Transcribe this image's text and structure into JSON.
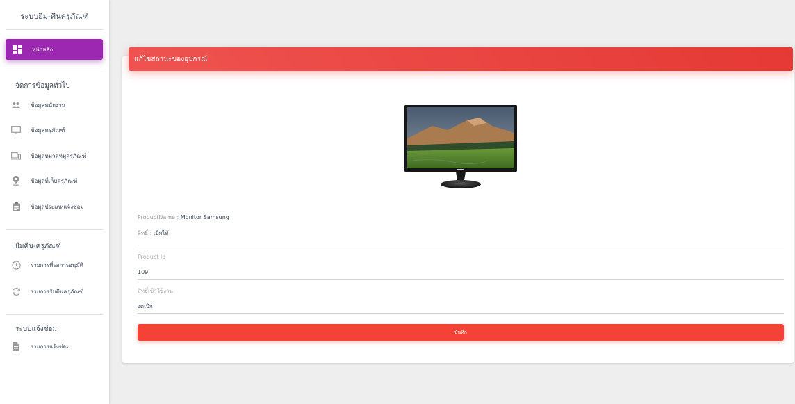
{
  "sidebar": {
    "title": "ระบบยืม-คืนครุภัณฑ์",
    "home_label": "หน้าหลัก",
    "sections": [
      {
        "label": "จัดการข้อมูลทั่วไป",
        "items": [
          {
            "label": "ข้อมูลพนักงาน",
            "icon": "people-icon"
          },
          {
            "label": "ข้อมูลครุภัณฑ์",
            "icon": "monitor-icon"
          },
          {
            "label": "ข้อมูลหมวดหมู่ครุภัณฑ์",
            "icon": "devices-icon"
          },
          {
            "label": "ข้อมูลที่เก็บครุภัณฑ์",
            "icon": "location-pin-icon"
          },
          {
            "label": "ข้อมูลประเภทแจ้งซ่อม",
            "icon": "clipboard-icon"
          }
        ]
      },
      {
        "label": "ยืมคืน-ครุภัณฑ์",
        "items": [
          {
            "label": "รายการที่รอการอนุมัติ",
            "icon": "clock-icon"
          },
          {
            "label": "รายการรับคืนครุภัณฑ์",
            "icon": "refresh-icon"
          }
        ]
      },
      {
        "label": "ระบบแจ้งซ่อม",
        "items": [
          {
            "label": "รายการแจ้งซ่อม",
            "icon": "document-icon"
          }
        ]
      }
    ]
  },
  "card": {
    "title": "แก้ไขสถานะของอุปกรณ์",
    "product_name_label": "ProductName : ",
    "product_name_value": "Monitor Samsung",
    "right_label": "สิทธิ์ : ",
    "right_value": "เบิกได้",
    "product_id_label": "Product Id",
    "product_id_value": "109",
    "usage_right_label": "สิทธิ์เข้าใช้งาน",
    "usage_right_value": "งดเบิก",
    "save_label": "บันทึก"
  },
  "colors": {
    "accent_purple": "#9c27b0",
    "header_red": "#e53935",
    "button_red": "#f44336"
  }
}
